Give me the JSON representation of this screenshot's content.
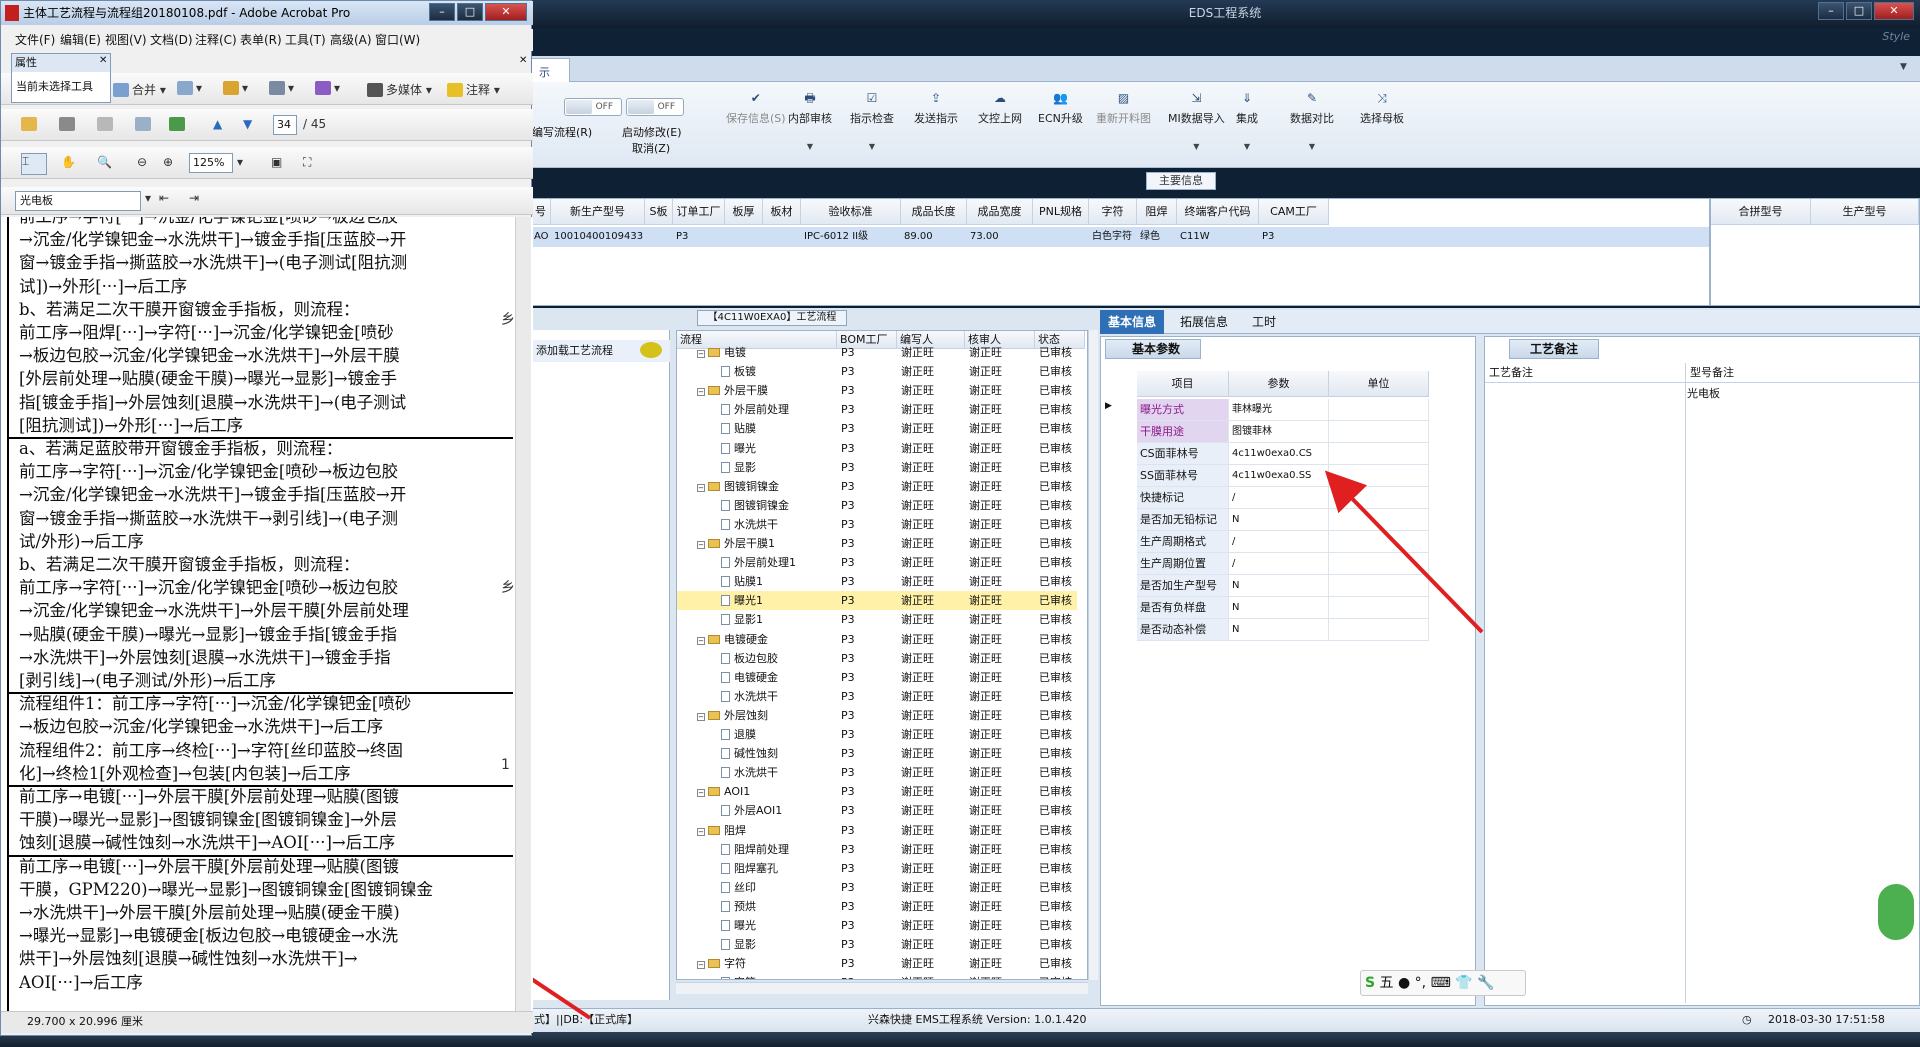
{
  "eds": {
    "title": "EDS工程系统",
    "brand": "Style",
    "tab_label": "示",
    "toggles": [
      "OFF",
      "OFF"
    ],
    "tool_edit_flow": "编写流程(R)",
    "tool_enable_mod": "启动修改(E)",
    "tool_cancel": "取消(Z)",
    "toolbar": [
      {
        "label": "保存信息(S)",
        "icon": "check-icon",
        "disabled": true
      },
      {
        "label": "内部审核",
        "icon": "print-icon"
      },
      {
        "label": "指示检查",
        "icon": "check-doc-icon"
      },
      {
        "label": "发送指示",
        "icon": "upload-icon"
      },
      {
        "label": "文控上网",
        "icon": "cloud-upload-icon"
      },
      {
        "label": "ECN升级",
        "icon": "users-icon"
      },
      {
        "label": "重新开料图",
        "icon": "image-icon",
        "disabled": true
      },
      {
        "label": "MI数据导入",
        "icon": "import-icon"
      },
      {
        "label": "集成",
        "icon": "download-icon"
      },
      {
        "label": "数据对比",
        "icon": "tools-icon"
      },
      {
        "label": "选择母板",
        "icon": "shuffle-icon"
      }
    ],
    "main_info_label": "主要信息",
    "info_headers": [
      "号",
      "新生产型号",
      "S板",
      "订单工厂",
      "板厚",
      "板材",
      "验收标准",
      "成品长度",
      "成品宽度",
      "PNL规格",
      "字符",
      "阻焊",
      "终端客户代码",
      "CAM工厂"
    ],
    "info_row": [
      "AO",
      "10010400109433",
      "",
      "P3",
      "",
      "",
      "IPC-6012 II级",
      "89.00",
      "73.00",
      "",
      "白色字符",
      "绿色",
      "C11W",
      "P3"
    ],
    "merge_headers": [
      "合拼型号",
      "生产型号"
    ],
    "load_flow": "添加载工艺流程",
    "flow_title": "【4C11W0EXA0】工艺流程",
    "flow_headers": [
      "流程",
      "BOM工厂",
      "编写人",
      "核审人",
      "状态"
    ],
    "flow_rows": [
      {
        "name": "电镀",
        "type": "folder",
        "level": 1,
        "bom": "P3",
        "writer": "谢正旺",
        "reviewer": "谢正旺",
        "status": "已审核"
      },
      {
        "name": "板镀",
        "type": "doc",
        "level": 2,
        "bom": "P3",
        "writer": "谢正旺",
        "reviewer": "谢正旺",
        "status": "已审核"
      },
      {
        "name": "外层干膜",
        "type": "folder",
        "level": 1,
        "bom": "P3",
        "writer": "谢正旺",
        "reviewer": "谢正旺",
        "status": "已审核"
      },
      {
        "name": "外层前处理",
        "type": "doc",
        "level": 2,
        "bom": "P3",
        "writer": "谢正旺",
        "reviewer": "谢正旺",
        "status": "已审核"
      },
      {
        "name": "贴膜",
        "type": "doc",
        "level": 2,
        "bom": "P3",
        "writer": "谢正旺",
        "reviewer": "谢正旺",
        "status": "已审核"
      },
      {
        "name": "曝光",
        "type": "doc",
        "level": 2,
        "bom": "P3",
        "writer": "谢正旺",
        "reviewer": "谢正旺",
        "status": "已审核"
      },
      {
        "name": "显影",
        "type": "doc",
        "level": 2,
        "bom": "P3",
        "writer": "谢正旺",
        "reviewer": "谢正旺",
        "status": "已审核"
      },
      {
        "name": "图镀铜镍金",
        "type": "folder",
        "level": 1,
        "bom": "P3",
        "writer": "谢正旺",
        "reviewer": "谢正旺",
        "status": "已审核"
      },
      {
        "name": "图镀铜镍金",
        "type": "doc",
        "level": 2,
        "bom": "P3",
        "writer": "谢正旺",
        "reviewer": "谢正旺",
        "status": "已审核"
      },
      {
        "name": "水洗烘干",
        "type": "doc",
        "level": 2,
        "bom": "P3",
        "writer": "谢正旺",
        "reviewer": "谢正旺",
        "status": "已审核"
      },
      {
        "name": "外层干膜1",
        "type": "folder",
        "level": 1,
        "bom": "P3",
        "writer": "谢正旺",
        "reviewer": "谢正旺",
        "status": "已审核"
      },
      {
        "name": "外层前处理1",
        "type": "doc",
        "level": 2,
        "bom": "P3",
        "writer": "谢正旺",
        "reviewer": "谢正旺",
        "status": "已审核"
      },
      {
        "name": "贴膜1",
        "type": "doc",
        "level": 2,
        "bom": "P3",
        "writer": "谢正旺",
        "reviewer": "谢正旺",
        "status": "已审核"
      },
      {
        "name": "曝光1",
        "type": "doc",
        "level": 2,
        "bom": "P3",
        "writer": "谢正旺",
        "reviewer": "谢正旺",
        "status": "已审核",
        "selected": true
      },
      {
        "name": "显影1",
        "type": "doc",
        "level": 2,
        "bom": "P3",
        "writer": "谢正旺",
        "reviewer": "谢正旺",
        "status": "已审核"
      },
      {
        "name": "电镀硬金",
        "type": "folder",
        "level": 1,
        "bom": "P3",
        "writer": "谢正旺",
        "reviewer": "谢正旺",
        "status": "已审核"
      },
      {
        "name": "板边包胶",
        "type": "doc",
        "level": 2,
        "bom": "P3",
        "writer": "谢正旺",
        "reviewer": "谢正旺",
        "status": "已审核"
      },
      {
        "name": "电镀硬金",
        "type": "doc",
        "level": 2,
        "bom": "P3",
        "writer": "谢正旺",
        "reviewer": "谢正旺",
        "status": "已审核"
      },
      {
        "name": "水洗烘干",
        "type": "doc",
        "level": 2,
        "bom": "P3",
        "writer": "谢正旺",
        "reviewer": "谢正旺",
        "status": "已审核"
      },
      {
        "name": "外层蚀刻",
        "type": "folder",
        "level": 1,
        "bom": "P3",
        "writer": "谢正旺",
        "reviewer": "谢正旺",
        "status": "已审核"
      },
      {
        "name": "退膜",
        "type": "doc",
        "level": 2,
        "bom": "P3",
        "writer": "谢正旺",
        "reviewer": "谢正旺",
        "status": "已审核"
      },
      {
        "name": "碱性蚀刻",
        "type": "doc",
        "level": 2,
        "bom": "P3",
        "writer": "谢正旺",
        "reviewer": "谢正旺",
        "status": "已审核"
      },
      {
        "name": "水洗烘干",
        "type": "doc",
        "level": 2,
        "bom": "P3",
        "writer": "谢正旺",
        "reviewer": "谢正旺",
        "status": "已审核"
      },
      {
        "name": "AOI1",
        "type": "folder",
        "level": 1,
        "bom": "P3",
        "writer": "谢正旺",
        "reviewer": "谢正旺",
        "status": "已审核"
      },
      {
        "name": "外层AOI1",
        "type": "doc",
        "level": 2,
        "bom": "P3",
        "writer": "谢正旺",
        "reviewer": "谢正旺",
        "status": "已审核"
      },
      {
        "name": "阻焊",
        "type": "folder",
        "level": 1,
        "bom": "P3",
        "writer": "谢正旺",
        "reviewer": "谢正旺",
        "status": "已审核"
      },
      {
        "name": "阻焊前处理",
        "type": "doc",
        "level": 2,
        "bom": "P3",
        "writer": "谢正旺",
        "reviewer": "谢正旺",
        "status": "已审核"
      },
      {
        "name": "阻焊塞孔",
        "type": "doc",
        "level": 2,
        "bom": "P3",
        "writer": "谢正旺",
        "reviewer": "谢正旺",
        "status": "已审核"
      },
      {
        "name": "丝印",
        "type": "doc",
        "level": 2,
        "bom": "P3",
        "writer": "谢正旺",
        "reviewer": "谢正旺",
        "status": "已审核"
      },
      {
        "name": "预烘",
        "type": "doc",
        "level": 2,
        "bom": "P3",
        "writer": "谢正旺",
        "reviewer": "谢正旺",
        "status": "已审核"
      },
      {
        "name": "曝光",
        "type": "doc",
        "level": 2,
        "bom": "P3",
        "writer": "谢正旺",
        "reviewer": "谢正旺",
        "status": "已审核"
      },
      {
        "name": "显影",
        "type": "doc",
        "level": 2,
        "bom": "P3",
        "writer": "谢正旺",
        "reviewer": "谢正旺",
        "status": "已审核"
      },
      {
        "name": "字符",
        "type": "folder",
        "level": 1,
        "bom": "P3",
        "writer": "谢正旺",
        "reviewer": "谢正旺",
        "status": "已审核"
      },
      {
        "name": "字符",
        "type": "doc",
        "level": 2,
        "bom": "P3",
        "writer": "谢正旺",
        "reviewer": "谢正旺",
        "status": "已审核"
      }
    ],
    "info_tabs": [
      "基本信息",
      "拓展信息",
      "工时"
    ],
    "params_title": "基本参数",
    "param_headers": [
      "项目",
      "参数",
      "单位"
    ],
    "params": [
      {
        "name": "曝光方式",
        "value": "菲林曝光",
        "highlight": true
      },
      {
        "name": "干膜用途",
        "value": "图镀菲林",
        "highlight": true
      },
      {
        "name": "CS面菲林号",
        "value": "4c11w0exa0.CS"
      },
      {
        "name": "SS面菲林号",
        "value": "4c11w0exa0.SS"
      },
      {
        "name": "快捷标记",
        "value": "/"
      },
      {
        "name": "是否加无铅标记",
        "value": "N"
      },
      {
        "name": "生产周期格式",
        "value": "/"
      },
      {
        "name": "生产周期位置",
        "value": "/"
      },
      {
        "name": "是否加生产型号",
        "value": "N"
      },
      {
        "name": "是否有负样盘",
        "value": "N"
      },
      {
        "name": "是否动态补偿",
        "value": "N"
      }
    ],
    "craft_title": "工艺备注",
    "craft_headers": [
      "工艺备注",
      "型号备注"
    ],
    "craft_note_value": "光电板",
    "status_left": "式】||DB:【正式库】",
    "status_center": "兴森快捷 EMS工程系统 Version: 1.0.1.420",
    "status_time": "2018-03-30 17:51:58",
    "ime_text": "五"
  },
  "acrobat": {
    "title": "主体工艺流程与流程组20180108.pdf - Adobe Acrobat Pro",
    "menu": [
      "文件(F)",
      "编辑(E)",
      "视图(V)",
      "文档(D)",
      "注释(C)",
      "表单(R)",
      "工具(T)",
      "高级(A)",
      "窗口(W)"
    ],
    "props_title": "属性",
    "props_text": "当前未选择工具",
    "tb1": [
      "合并",
      "多媒体",
      "注释"
    ],
    "page_current": "34",
    "page_total": "/ 45",
    "zoom": "125%",
    "search": "光电板",
    "status": "29.700 x 20.996 厘米",
    "doc_lines": [
      "前工序→字符[···]→沉金/化学镍钯金[喷砂→板边包胶",
      "→沉金/化学镍钯金→水洗烘干]→镀金手指[压蓝胶→开",
      "窗→镀金手指→撕蓝胶→水洗烘干]→(电子测试[阻抗测",
      "试])→外形[···]→后工序",
      "b、若满足二次干膜开窗镀金手指板，则流程：",
      "前工序→阻焊[···]→字符[···]→沉金/化学镍钯金[喷砂",
      "→板边包胶→沉金/化学镍钯金→水洗烘干]→外层干膜",
      "[外层前处理→贴膜(硬金干膜)→曝光→显影]→镀金手",
      "指[镀金手指]→外层蚀刻[退膜→水洗烘干]→(电子测试",
      "[阻抗测试])→外形[···]→后工序",
      "a、若满足蓝胶带开窗镀金手指板，则流程：",
      "前工序→字符[···]→沉金/化学镍钯金[喷砂→板边包胶",
      "→沉金/化学镍钯金→水洗烘干]→镀金手指[压蓝胶→开",
      "窗→镀金手指→撕蓝胶→水洗烘干→剥引线]→(电子测",
      "试/外形)→后工序",
      "b、若满足二次干膜开窗镀金手指板，则流程：",
      "前工序→字符[···]→沉金/化学镍钯金[喷砂→板边包胶",
      "→沉金/化学镍钯金→水洗烘干]→外层干膜[外层前处理",
      "→贴膜(硬金干膜)→曝光→显影]→镀金手指[镀金手指",
      "→水洗烘干]→外层蚀刻[退膜→水洗烘干]→镀金手指",
      "[剥引线]→(电子测试/外形)→后工序",
      "流程组件1：前工序→字符[···]→沉金/化学镍钯金[喷砂",
      "→板边包胶→沉金/化学镍钯金→水洗烘干]→后工序",
      "流程组件2：前工序→终检[···]→字符[丝印蓝胶→终固",
      "化]→终检1[外观检查]→包装[内包装]→后工序",
      "前工序→电镀[···]→外层干膜[外层前处理→贴膜(图镀",
      "干膜)→曝光→显影]→图镀铜镍金[图镀铜镍金]→外层",
      "蚀刻[退膜→碱性蚀刻→水洗烘干]→AOI[···]→后工序",
      "前工序→电镀[···]→外层干膜[外层前处理→贴膜(图镀",
      "干膜，GPM220)→曝光→显影]→图镀铜镍金[图镀铜镍金",
      "→水洗烘干]→外层干膜[外层前处理→贴膜(硬金干膜)",
      "→曝光→显影]→电镀硬金[板边包胶→电镀硬金→水洗",
      "烘干]→外层蚀刻[退膜→碱性蚀刻→水洗烘干]→",
      "AOI[···]→后工序"
    ],
    "right_marks": [
      "乡",
      "乡",
      "1"
    ]
  },
  "colors": {
    "accent": "#2f6fb6",
    "highlight_row": "#fff1a8",
    "arrow": "#e02020"
  }
}
